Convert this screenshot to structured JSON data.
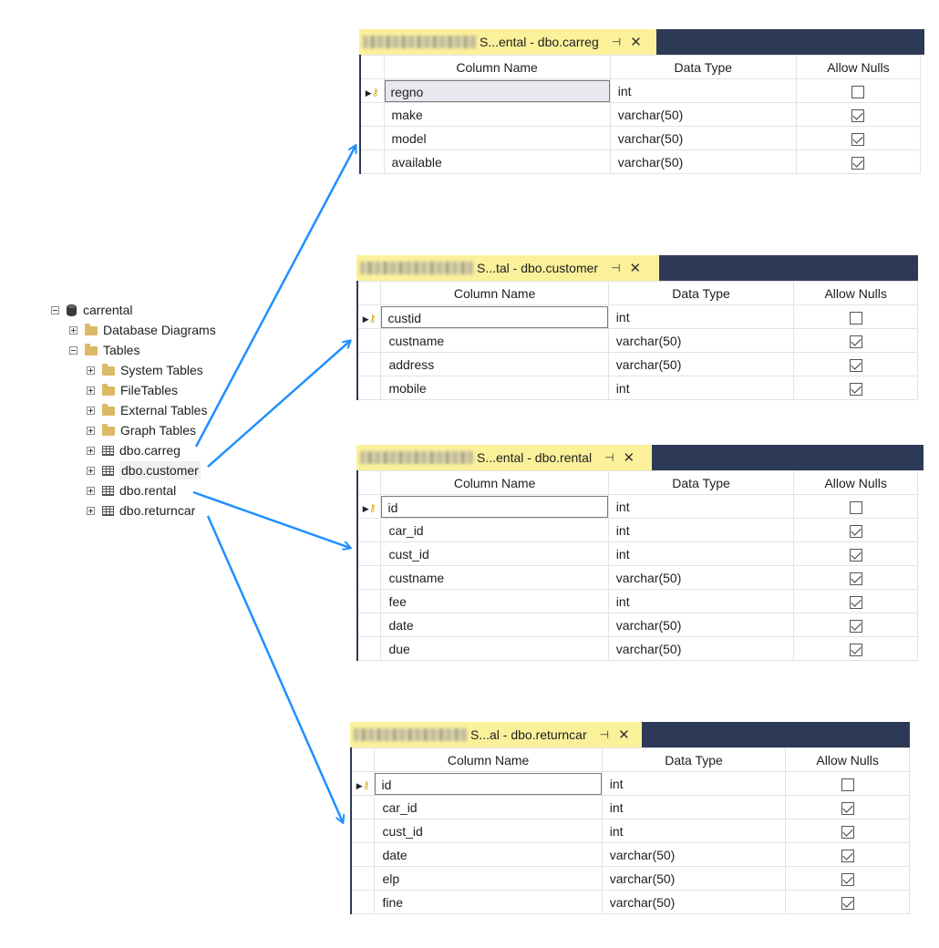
{
  "tree": {
    "database": "carrental",
    "items": [
      {
        "label": "Database Diagrams"
      },
      {
        "label": "Tables"
      },
      {
        "label": "System Tables"
      },
      {
        "label": "FileTables"
      },
      {
        "label": "External Tables"
      },
      {
        "label": "Graph Tables"
      },
      {
        "label": "dbo.carreg"
      },
      {
        "label": "dbo.customer"
      },
      {
        "label": "dbo.rental"
      },
      {
        "label": "dbo.returncar"
      }
    ]
  },
  "grid_headers": {
    "column_name": "Column Name",
    "data_type": "Data Type",
    "allow_nulls": "Allow Nulls"
  },
  "tab_icons": {
    "pin": "pin-icon",
    "close": "close-icon"
  },
  "panels": [
    {
      "tab_title": "S...ental - dbo.carreg",
      "rows": [
        {
          "name": "regno",
          "type": "int",
          "nulls": false,
          "key": true
        },
        {
          "name": "make",
          "type": "varchar(50)",
          "nulls": true
        },
        {
          "name": "model",
          "type": "varchar(50)",
          "nulls": true
        },
        {
          "name": "available",
          "type": "varchar(50)",
          "nulls": true
        }
      ]
    },
    {
      "tab_title": "S...tal - dbo.customer",
      "rows": [
        {
          "name": "custid",
          "type": "int",
          "nulls": false,
          "key": true
        },
        {
          "name": "custname",
          "type": "varchar(50)",
          "nulls": true
        },
        {
          "name": "address",
          "type": "varchar(50)",
          "nulls": true
        },
        {
          "name": "mobile",
          "type": "int",
          "nulls": true
        }
      ]
    },
    {
      "tab_title": "S...ental - dbo.rental",
      "rows": [
        {
          "name": "id",
          "type": "int",
          "nulls": false,
          "key": true
        },
        {
          "name": "car_id",
          "type": "int",
          "nulls": true
        },
        {
          "name": "cust_id",
          "type": "int",
          "nulls": true
        },
        {
          "name": "custname",
          "type": "varchar(50)",
          "nulls": true
        },
        {
          "name": "fee",
          "type": "int",
          "nulls": true
        },
        {
          "name": "date",
          "type": "varchar(50)",
          "nulls": true
        },
        {
          "name": "due",
          "type": "varchar(50)",
          "nulls": true
        }
      ]
    },
    {
      "tab_title": "S...al - dbo.returncar",
      "rows": [
        {
          "name": "id",
          "type": "int",
          "nulls": false,
          "key": true
        },
        {
          "name": "car_id",
          "type": "int",
          "nulls": true
        },
        {
          "name": "cust_id",
          "type": "int",
          "nulls": true
        },
        {
          "name": "date",
          "type": "varchar(50)",
          "nulls": true
        },
        {
          "name": "elp",
          "type": "varchar(50)",
          "nulls": true
        },
        {
          "name": "fine",
          "type": "varchar(50)",
          "nulls": true
        }
      ]
    }
  ],
  "colors": {
    "tabbar": "#2d3a57",
    "tab": "#fbf19b",
    "arrow": "#1e90ff",
    "folder": "#dcb967"
  }
}
